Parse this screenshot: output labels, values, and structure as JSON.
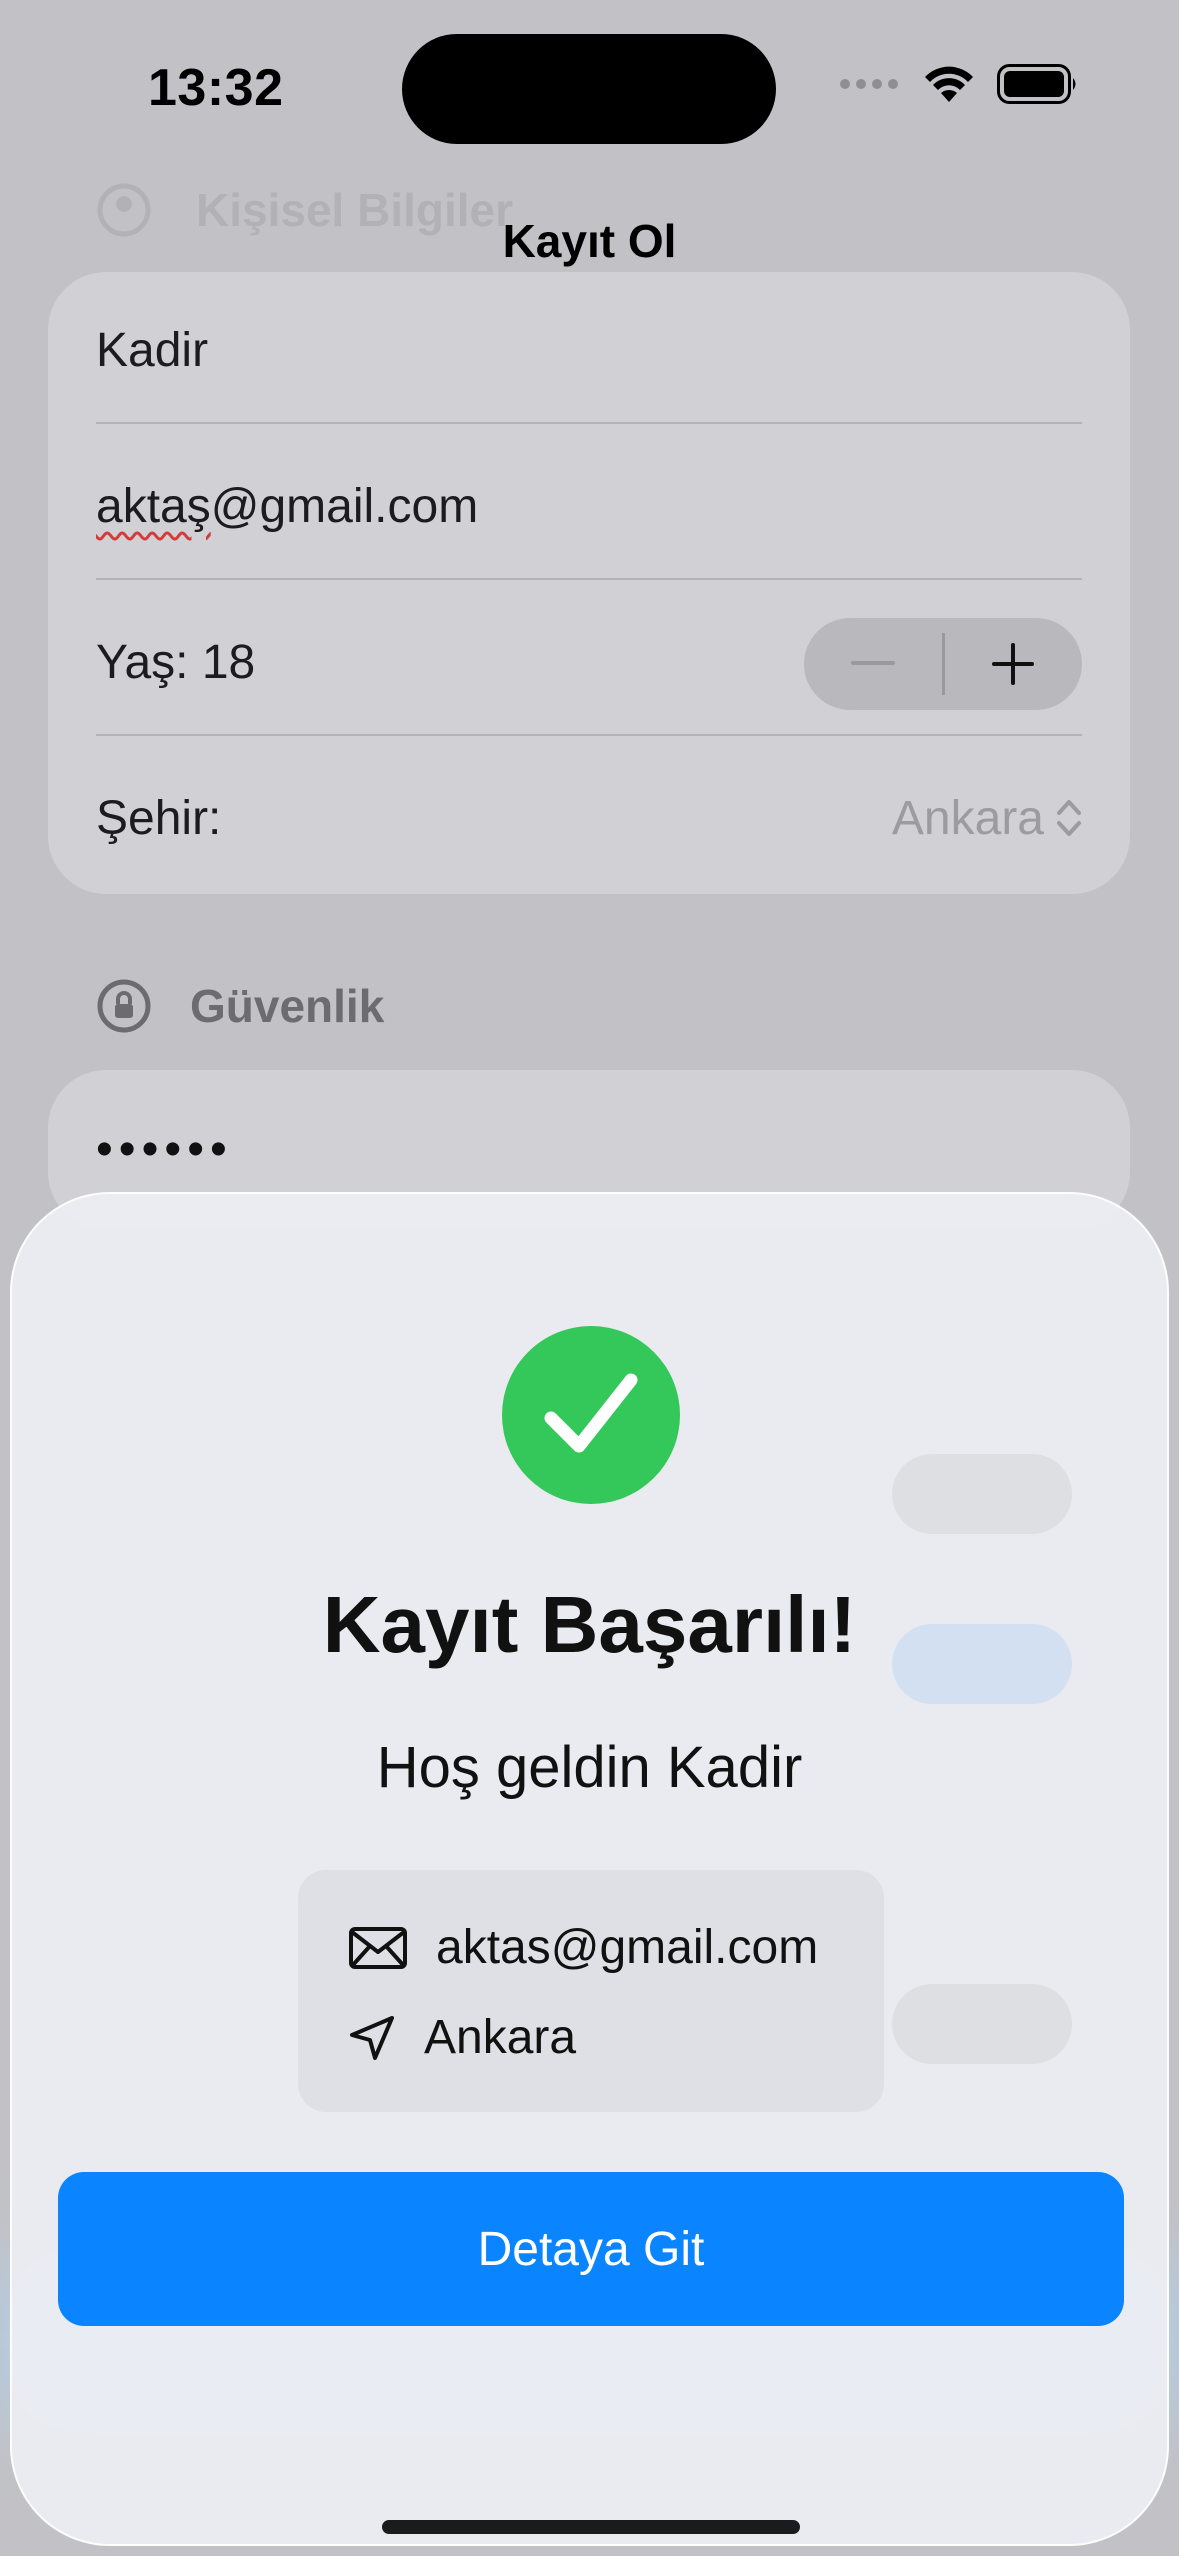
{
  "status_bar": {
    "time": "13:32"
  },
  "nav": {
    "title": "Kayıt Ol"
  },
  "form": {
    "personal_section_title": "Kişisel Bilgiler",
    "name_value": "Kadir",
    "email_value_part1": "aktaş",
    "email_value_part2": "@gmail.com",
    "age_label": "Yaş: 18",
    "city_label": "Şehir:",
    "city_value": "Ankara",
    "security_section_title": "Güvenlik",
    "password_value": "••••••"
  },
  "sheet": {
    "title": "Kayıt Başarılı!",
    "welcome": "Hoş geldin Kadir",
    "email": "aktas@gmail.com",
    "city": "Ankara",
    "button_label": "Detaya Git"
  },
  "colors": {
    "success_green": "#34c759",
    "accent_blue": "#0a84ff"
  }
}
